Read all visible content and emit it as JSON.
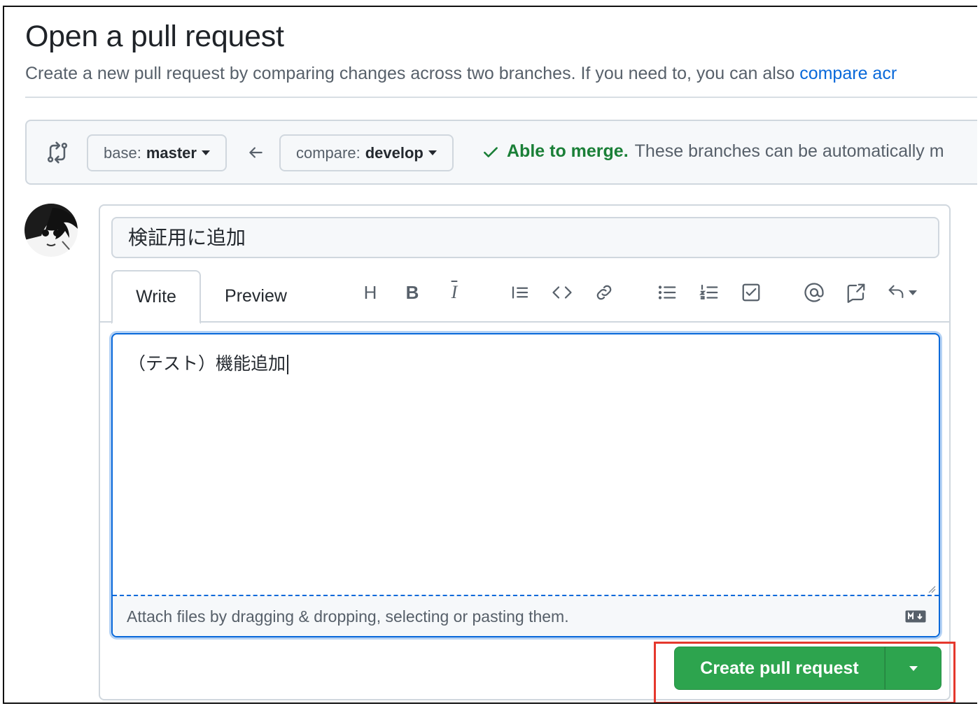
{
  "header": {
    "title": "Open a pull request",
    "subtitle_prefix": "Create a new pull request by comparing changes across two branches. If you need to, you can also ",
    "subtitle_link": "compare acr"
  },
  "branches": {
    "compare_icon": "git-compare-icon",
    "base_label": "base:",
    "base_value": "master",
    "arrow_icon": "arrow-left-icon",
    "compare_label": "compare:",
    "compare_value": "develop",
    "merge_ok": "Able to merge.",
    "merge_text": "These branches can be automatically m",
    "merge_color": "#1a7f37"
  },
  "composer": {
    "title_value": "検証用に追加",
    "tabs": [
      "Write",
      "Preview"
    ],
    "toolbar": [
      {
        "name": "heading-icon",
        "glyph": "H"
      },
      {
        "name": "bold-icon",
        "glyph": "B"
      },
      {
        "name": "italic-icon",
        "glyph": "I"
      },
      {
        "name": "quote-icon",
        "glyph": ""
      },
      {
        "name": "code-icon",
        "glyph": ""
      },
      {
        "name": "link-icon",
        "glyph": ""
      },
      {
        "name": "unordered-list-icon",
        "glyph": ""
      },
      {
        "name": "ordered-list-icon",
        "glyph": ""
      },
      {
        "name": "task-list-icon",
        "glyph": ""
      },
      {
        "name": "mention-icon",
        "glyph": ""
      },
      {
        "name": "cross-reference-icon",
        "glyph": ""
      },
      {
        "name": "saved-replies-icon",
        "glyph": ""
      }
    ],
    "body_value": "（テスト）機能追加",
    "dropzone_text": "Attach files by dragging & dropping, selecting or pasting them.",
    "markdown_icon": "markdown-icon"
  },
  "actions": {
    "create_label": "Create pull request",
    "accent": "#2da44e",
    "highlight_color": "#e5382d"
  }
}
